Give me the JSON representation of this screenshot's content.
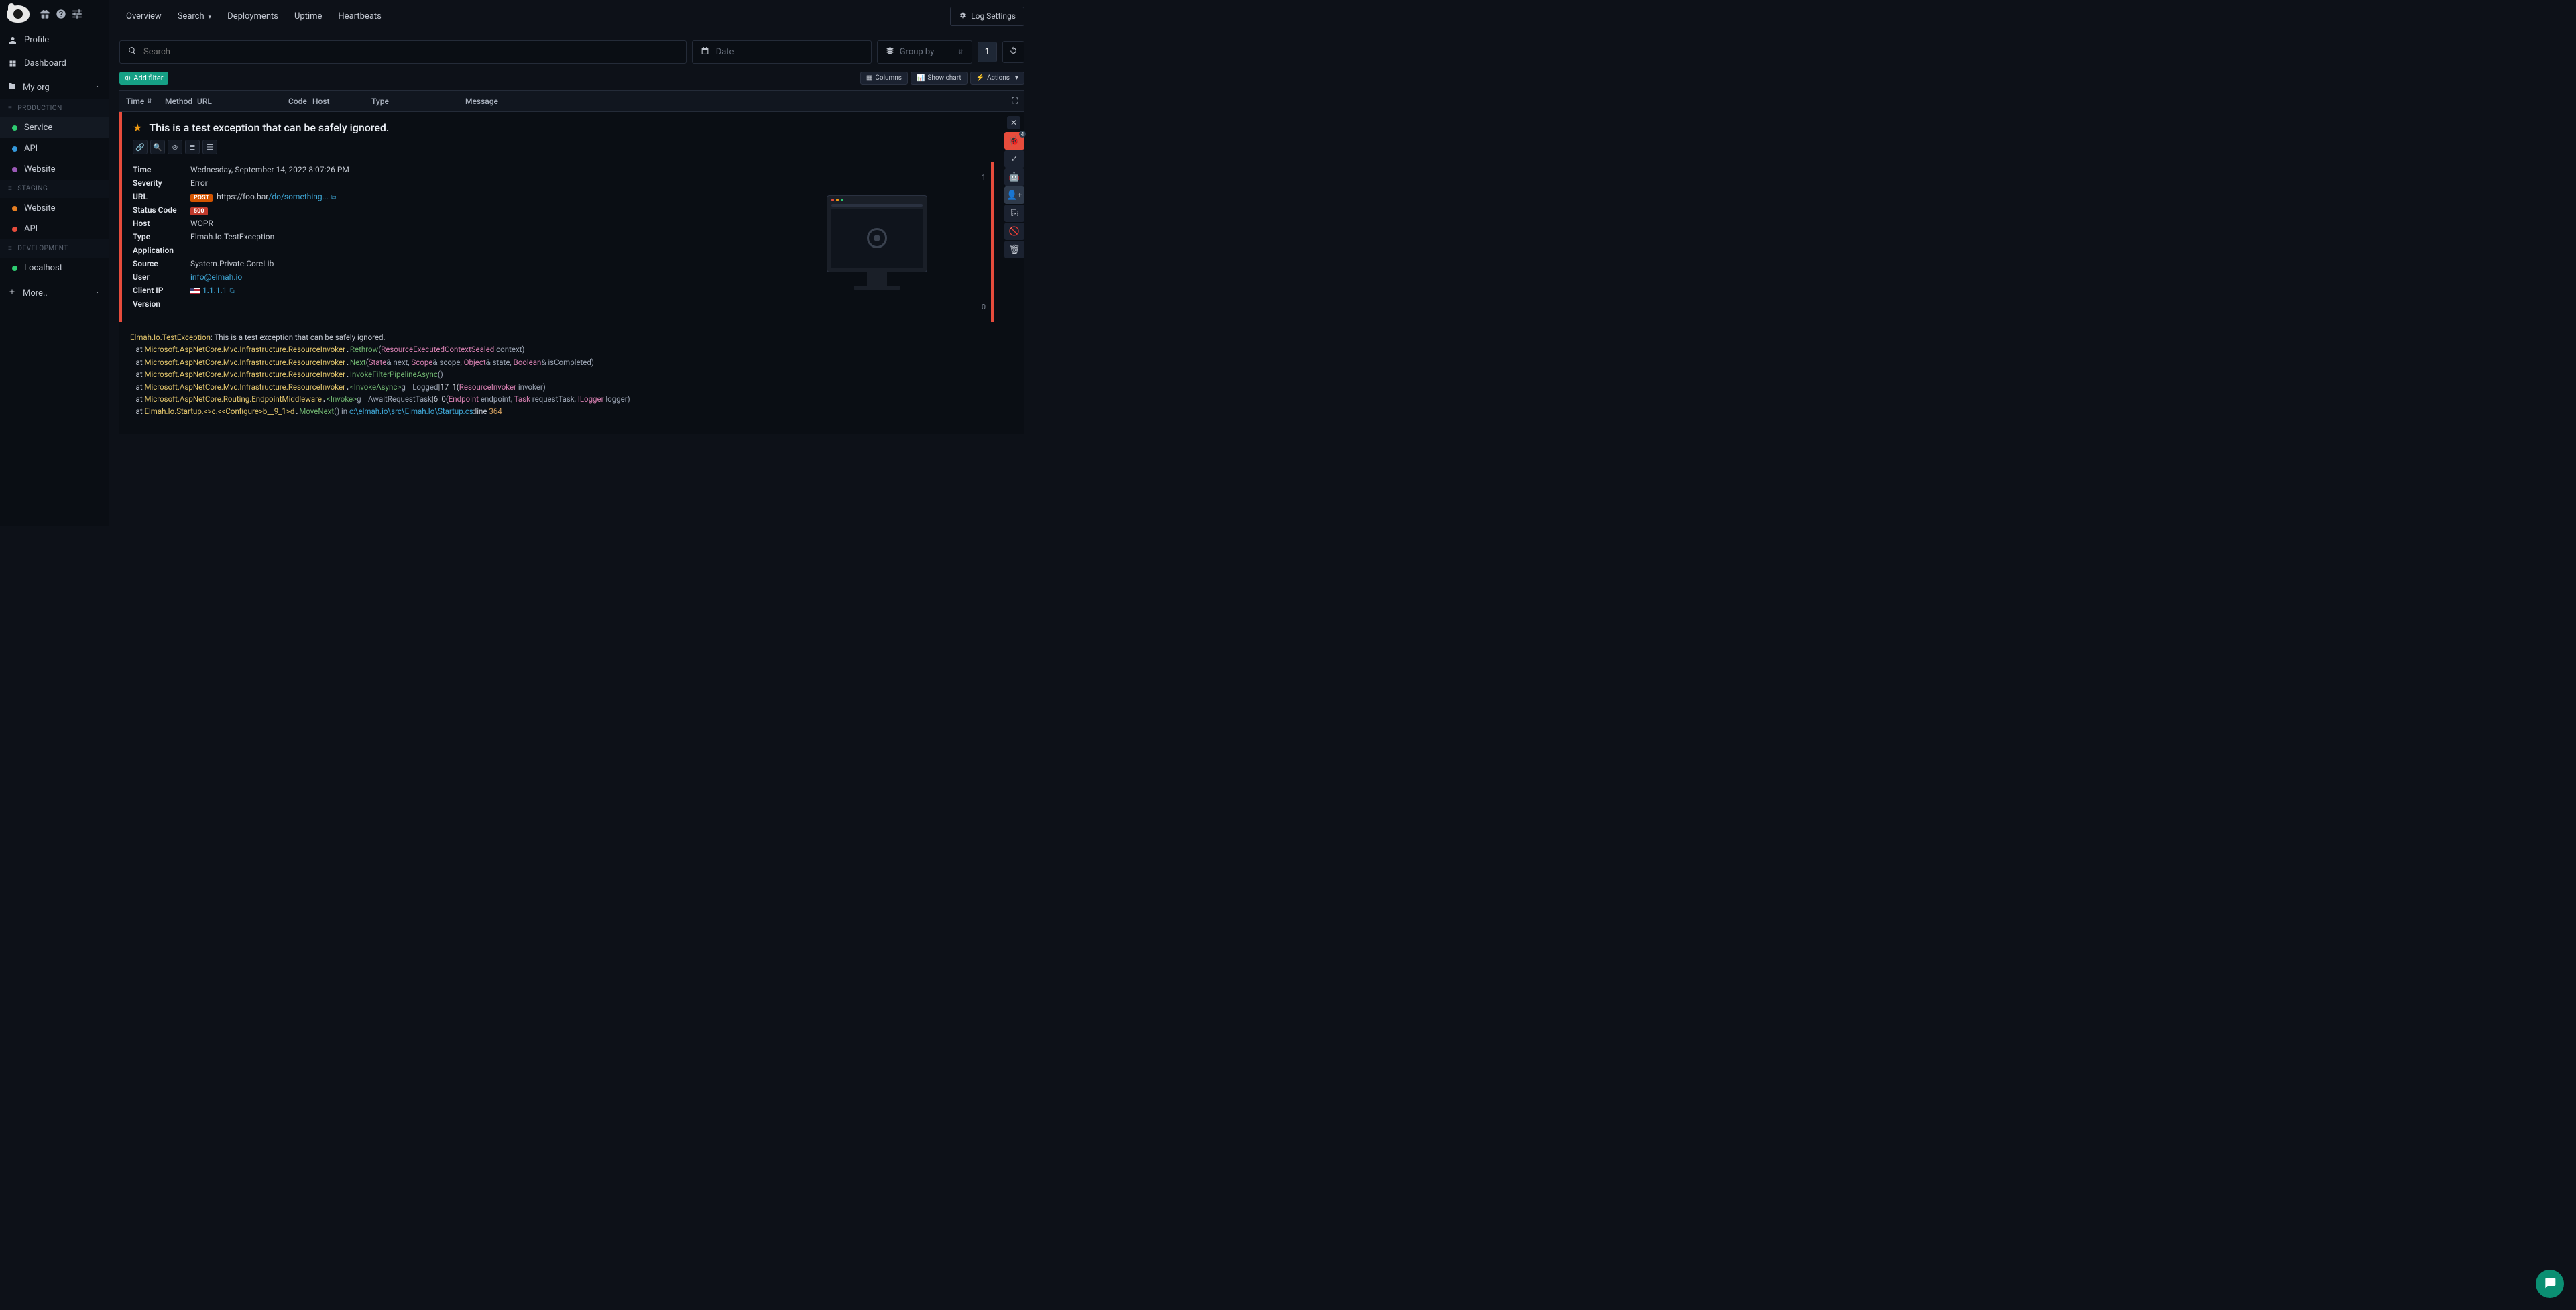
{
  "topbar": {
    "nav": [
      "Overview",
      "Search",
      "Deployments",
      "Uptime",
      "Heartbeats"
    ],
    "log_settings": "Log Settings"
  },
  "sidebar": {
    "profile": "Profile",
    "dashboard": "Dashboard",
    "org": "My org",
    "more": "More..",
    "sections": [
      {
        "name": "PRODUCTION",
        "items": [
          {
            "label": "Service",
            "color": "green",
            "active": true
          },
          {
            "label": "API",
            "color": "blue"
          },
          {
            "label": "Website",
            "color": "purple"
          }
        ]
      },
      {
        "name": "STAGING",
        "items": [
          {
            "label": "Website",
            "color": "orange"
          },
          {
            "label": "API",
            "color": "red"
          }
        ]
      },
      {
        "name": "DEVELOPMENT",
        "items": [
          {
            "label": "Localhost",
            "color": "green"
          }
        ]
      }
    ]
  },
  "toolbar": {
    "search_placeholder": "Search",
    "date_placeholder": "Date",
    "group_placeholder": "Group by",
    "page": "1",
    "add_filter": "Add filter",
    "columns": "Columns",
    "show_chart": "Show chart",
    "actions": "Actions"
  },
  "table": {
    "headers": [
      "Time",
      "Method",
      "URL",
      "Code",
      "Host",
      "Type",
      "Message"
    ]
  },
  "detail": {
    "title": "This is a test exception that can be safely ignored.",
    "fields": {
      "time_k": "Time",
      "time_v": "Wednesday, September 14, 2022 8:07:26 PM",
      "severity_k": "Severity",
      "severity_v": "Error",
      "url_k": "URL",
      "url_host": "https://foo.bar",
      "url_path": "/do/something...",
      "status_k": "Status Code",
      "status_v": "500",
      "host_k": "Host",
      "host_v": "WOPR",
      "type_k": "Type",
      "type_v": "Elmah.Io.TestException",
      "app_k": "Application",
      "source_k": "Source",
      "source_v": "System.Private.CoreLib",
      "user_k": "User",
      "user_v": "info@elmah.io",
      "ip_k": "Client IP",
      "ip_v": "1.1.1.1",
      "version_k": "Version"
    },
    "method_badge": "POST",
    "scale_top": "1",
    "scale_bottom": "0",
    "rail_badge": "4"
  },
  "stack": {
    "l0_a": "Elmah.Io.TestException",
    "l0_b": ": This is a test exception that can be safely ignored.",
    "at": "   at ",
    "ns": "Microsoft.AspNetCore.Mvc.Infrastructure.ResourceInvoker",
    "l1_m": "Rethrow",
    "l1_p": "(",
    "l1_t": "ResourceExecutedContextSealed",
    "l1_e": " context)",
    "l2_m": "Next",
    "l2_p": "(",
    "l2_t1": "State",
    "l2_a1": "& next, ",
    "l2_t2": "Scope",
    "l2_a2": "& scope, ",
    "l2_t3": "Object",
    "l2_a3": "& state, ",
    "l2_t4": "Boolean",
    "l2_a4": "& isCompleted)",
    "l3_m": "InvokeFilterPipelineAsync",
    "l3_e": "()",
    "l4_m": "<InvokeAsync>",
    "l4_g": "g__Logged",
    "l4_b": "|17_1",
    "l4_p": "(",
    "l4_t": "ResourceInvoker",
    "l4_e": " invoker)",
    "ns2": "Microsoft.AspNetCore.Routing.EndpointMiddleware",
    "l5_m": "<Invoke>",
    "l5_g": "g__AwaitRequestTask",
    "l5_b": "|6_0",
    "l5_p": "(",
    "l5_t1": "Endpoint",
    "l5_a1": " endpoint, ",
    "l5_t2": "Task",
    "l5_a2": " requestTask, ",
    "l5_t3": "ILogger",
    "l5_a3": " logger)",
    "ns3": "Elmah.Io.Startup.<>c.<<Configure>b__9_1>d",
    "l6_m": "MoveNext",
    "l6_e": "() in ",
    "l6_src": "c:\\elmah.io\\src\\Elmah.Io\\Startup.cs",
    "l6_ln": ":line ",
    "l6_num": "364"
  }
}
